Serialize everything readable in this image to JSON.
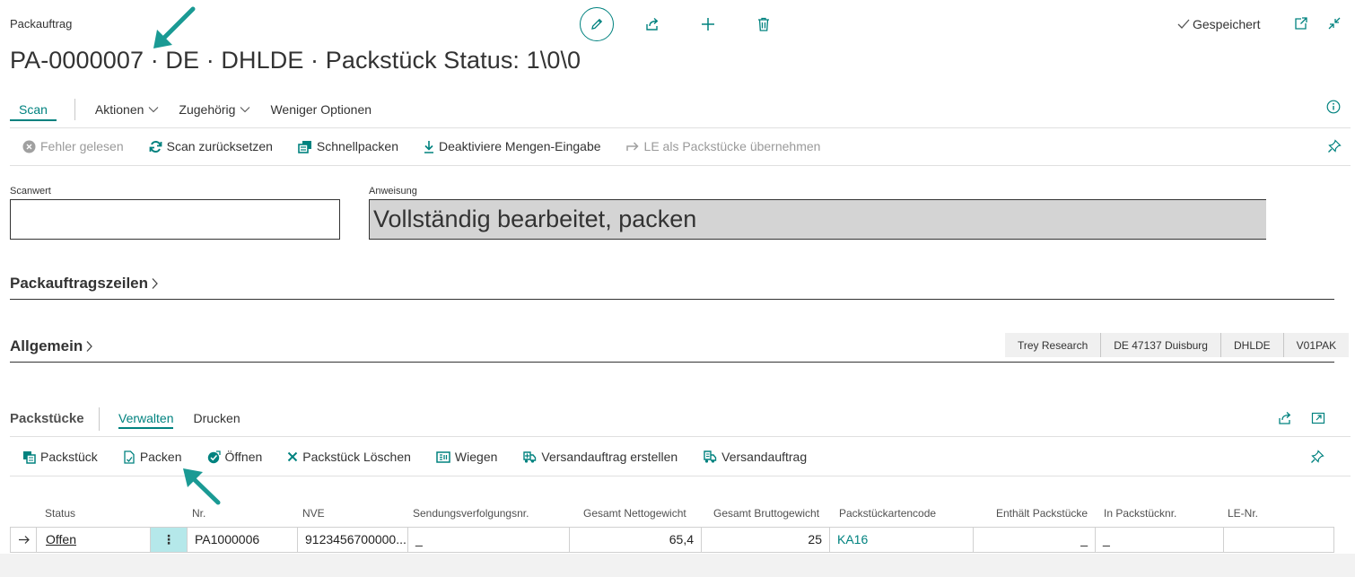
{
  "header": {
    "caption": "Packauftrag",
    "title": "PA-0000007 · DE · DHLDE · Packstück Status: 1\\0\\0",
    "saved_label": "Gespeichert"
  },
  "tabs": {
    "scan": "Scan",
    "aktionen": "Aktionen",
    "zugehoerig": "Zugehörig",
    "weniger": "Weniger Optionen"
  },
  "toolbar": {
    "fehler": "Fehler gelesen",
    "scan_reset": "Scan zurücksetzen",
    "schnellpacken": "Schnellpacken",
    "deaktiviere": "Deaktiviere Mengen-Eingabe",
    "le_uebernehmen": "LE als Packstücke übernehmen"
  },
  "fields": {
    "scanwert_label": "Scanwert",
    "scanwert_value": "",
    "anweisung_label": "Anweisung",
    "anweisung_value": "Vollständig bearbeitet, packen"
  },
  "sections": {
    "zeilen": "Packauftragszeilen",
    "allgemein": "Allgemein",
    "pills": [
      "Trey Research",
      "DE 47137 Duisburg",
      "DHLDE",
      "V01PAK"
    ]
  },
  "packstuecke": {
    "title": "Packstücke",
    "tab_verwalten": "Verwalten",
    "tab_drucken": "Drucken",
    "actions": {
      "packstueck": "Packstück",
      "packen": "Packen",
      "oeffnen": "Öffnen",
      "loeschen": "Packstück Löschen",
      "wiegen": "Wiegen",
      "versand_erstellen": "Versandauftrag erstellen",
      "versandauftrag": "Versandauftrag"
    },
    "columns": {
      "status": "Status",
      "nr": "Nr.",
      "nve": "NVE",
      "sendung": "Sendungsverfolgungsnr.",
      "netto": "Gesamt Nettogewicht",
      "brutto": "Gesamt Bruttogewicht",
      "kartencode": "Packstückartencode",
      "enthaelt": "Enthält Packstücke",
      "in_packstueck": "In Packstücknr.",
      "le_nr": "LE-Nr."
    },
    "row": {
      "status": "Offen",
      "menu": "⋮",
      "nr": "PA1000006",
      "nve": "9123456700000...",
      "sendung": "_",
      "netto": "65,4",
      "brutto": "25",
      "kartencode": "KA16",
      "enthaelt": "_",
      "in_packstueck": "_",
      "le_nr": ""
    }
  },
  "colors": {
    "accent": "#00827f",
    "annotation_arrow": "#1a9a94",
    "selected_cell": "#b5e8ea",
    "instruction_bg": "#d4d4d4"
  }
}
